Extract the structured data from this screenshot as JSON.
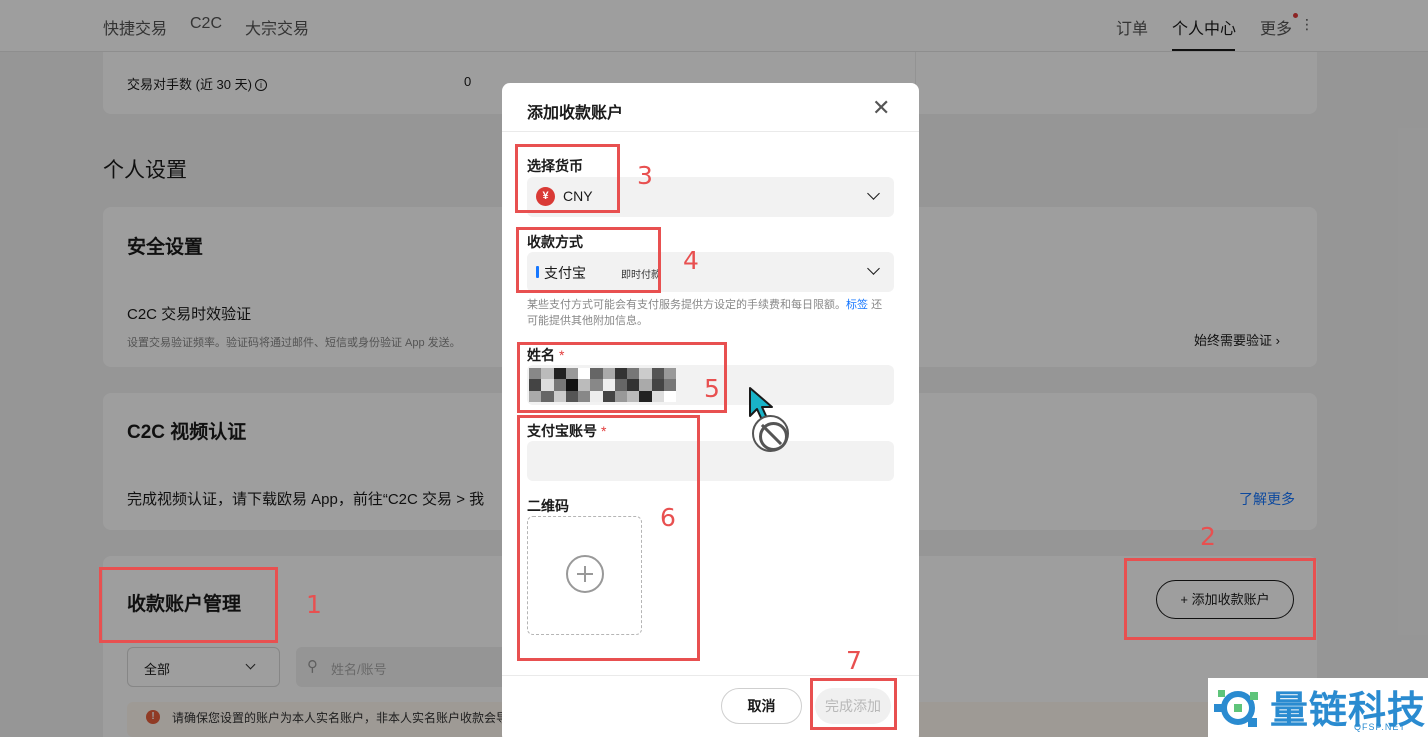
{
  "nav": {
    "left": [
      "快捷交易",
      "C2C",
      "大宗交易"
    ],
    "right": [
      "订单",
      "个人中心",
      "更多"
    ],
    "active": "个人中心"
  },
  "stats": {
    "label": "交易对手数 (近 30 天)",
    "info_icon": "info-icon",
    "value": "0"
  },
  "personal_settings_title": "个人设置",
  "security": {
    "title": "安全设置",
    "item_title": "C2C 交易时效验证",
    "item_desc": "设置交易验证频率。验证码将通过邮件、短信或身份验证 App 发送。",
    "action": "始终需要验证 ›"
  },
  "video": {
    "title": "C2C 视频认证",
    "desc": "完成视频认证，请下载欧易 App，前往“C2C 交易 > 我",
    "link": "了解更多"
  },
  "accounts": {
    "title": "收款账户管理",
    "add_button": "+ 添加收款账户",
    "filter_value": "全部",
    "search_placeholder": "姓名/账号",
    "notice": "请确保您设置的账户为本人实名账户，非本人实名账户收款会导"
  },
  "modal": {
    "title": "添加收款账户",
    "currency_label": "选择货币",
    "currency_value": "CNY",
    "currency_icon_text": "¥",
    "method_label": "收款方式",
    "method_value": "支付宝",
    "method_tag": "即时付款",
    "hint_text": "某些支付方式可能会有支付服务提供方设定的手续费和每日限额。",
    "hint_link": "标签",
    "hint_tail": "还可能提供其他附加信息。",
    "name_label": "姓名",
    "account_label": "支付宝账号",
    "required_mark": "*",
    "qr_label": "二维码",
    "cancel": "取消",
    "confirm": "完成添加"
  },
  "annotations": [
    "1",
    "2",
    "3",
    "4",
    "5",
    "6",
    "7"
  ],
  "watermark": {
    "text": "量链科技",
    "sub": "QFSP.NET"
  },
  "colors": {
    "annotation": "#e85050",
    "link": "#1677ff",
    "cny": "#d93a36",
    "watermark": "#2a8bd0"
  }
}
